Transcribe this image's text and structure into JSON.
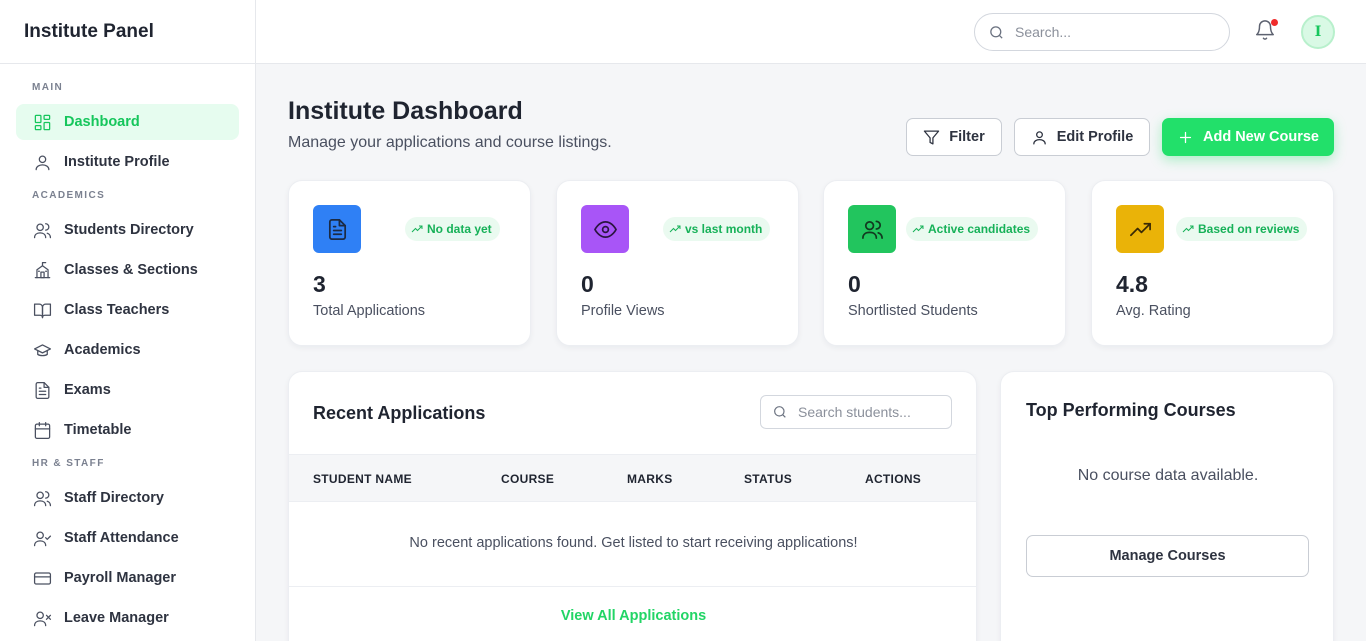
{
  "sidebar": {
    "brand": "Institute Panel",
    "sections": [
      {
        "title": "MAIN",
        "items": [
          {
            "label": "Dashboard",
            "icon": "dashboard-grid-icon",
            "active": true
          },
          {
            "label": "Institute Profile",
            "icon": "user-icon"
          }
        ]
      },
      {
        "title": "ACADEMICS",
        "items": [
          {
            "label": "Students Directory",
            "icon": "users-icon"
          },
          {
            "label": "Classes & Sections",
            "icon": "school-icon"
          },
          {
            "label": "Class Teachers",
            "icon": "book-open-icon"
          },
          {
            "label": "Academics",
            "icon": "graduation-cap-icon"
          },
          {
            "label": "Exams",
            "icon": "file-text-icon"
          },
          {
            "label": "Timetable",
            "icon": "calendar-icon"
          }
        ]
      },
      {
        "title": "HR & STAFF",
        "items": [
          {
            "label": "Staff Directory",
            "icon": "users-icon"
          },
          {
            "label": "Staff Attendance",
            "icon": "user-check-icon"
          },
          {
            "label": "Payroll Manager",
            "icon": "credit-card-icon"
          },
          {
            "label": "Leave Manager",
            "icon": "user-x-icon"
          }
        ]
      }
    ]
  },
  "topbar": {
    "search_placeholder": "Search...",
    "avatar_initial": "I",
    "notification_dot_color": "#ef2b2b"
  },
  "header": {
    "title": "Institute Dashboard",
    "subtitle": "Manage your applications and course listings.",
    "filter_label": "Filter",
    "edit_profile_label": "Edit Profile",
    "add_course_label": "Add New Course"
  },
  "stats": [
    {
      "value": "3",
      "label": "Total Applications",
      "badge": "No data yet",
      "icon": "file-text-icon",
      "color": "#2f80f5"
    },
    {
      "value": "0",
      "label": "Profile Views",
      "badge": "vs last month",
      "icon": "eye-icon",
      "color": "#a855f7"
    },
    {
      "value": "0",
      "label": "Shortlisted Students",
      "badge": "Active candidates",
      "icon": "users-icon",
      "color": "#22c55e"
    },
    {
      "value": "4.8",
      "label": "Avg. Rating",
      "badge": "Based on reviews",
      "icon": "trending-up-icon",
      "color": "#eab308"
    }
  ],
  "recent_applications": {
    "title": "Recent Applications",
    "search_placeholder": "Search students...",
    "columns": [
      "STUDENT NAME",
      "COURSE",
      "MARKS",
      "STATUS",
      "ACTIONS"
    ],
    "empty_message": "No recent applications found. Get listed to start receiving applications!",
    "view_all_label": "View All Applications"
  },
  "top_courses": {
    "title": "Top Performing Courses",
    "empty_message": "No course data available.",
    "manage_label": "Manage Courses"
  },
  "colors": {
    "accent": "#22e06a",
    "accent_text": "#16c65c",
    "active_bg": "#e6fcef"
  }
}
